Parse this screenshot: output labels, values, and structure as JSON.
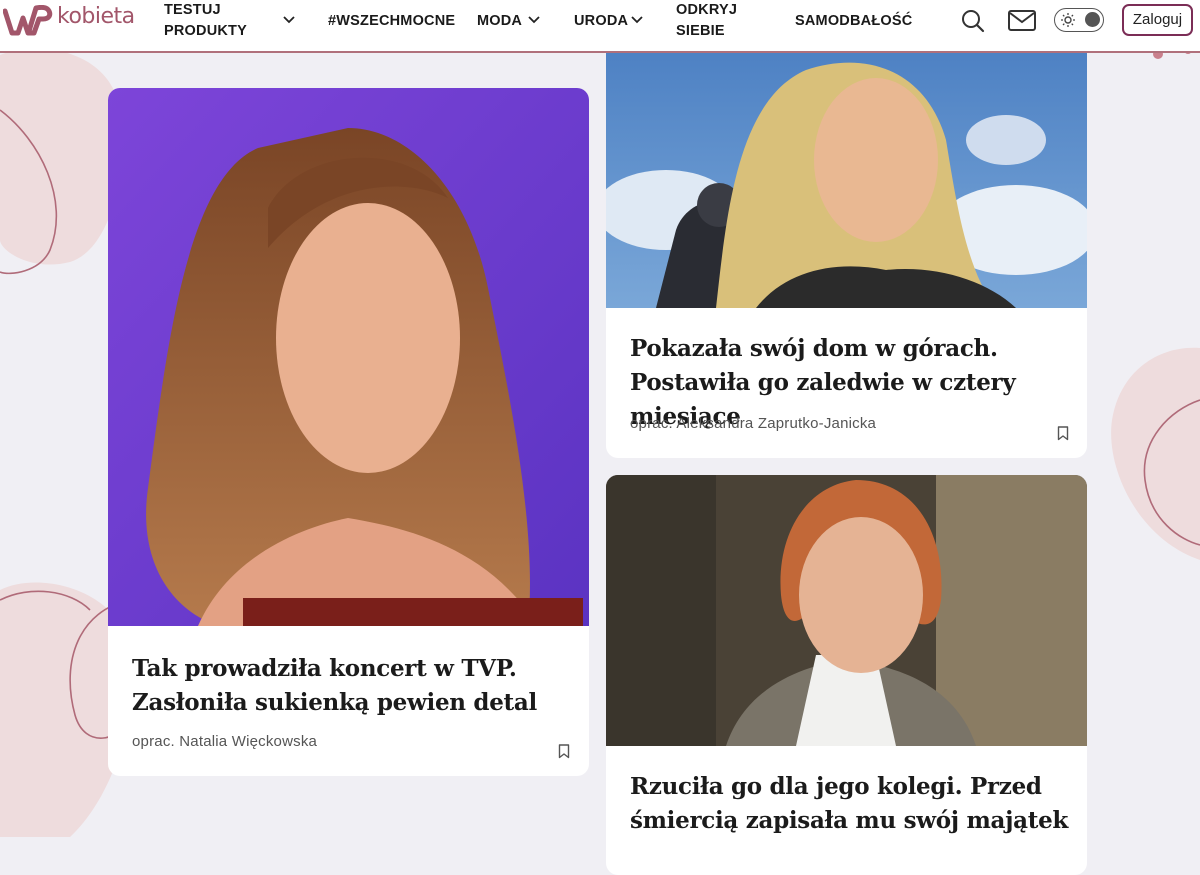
{
  "header": {
    "logo_text": "kobieta",
    "nav": [
      {
        "line1": "TESTUJ",
        "line2": "PRODUKTY"
      },
      {
        "label": "#WSZECHMOCNE"
      },
      {
        "label": "MODA"
      },
      {
        "label": "URODA"
      },
      {
        "line1": "ODKRYJ",
        "line2": "SIEBIE"
      },
      {
        "label": "SAMODBAŁOŚĆ"
      }
    ],
    "login_label": "Zaloguj"
  },
  "articles": [
    {
      "title": "Tak prowadziła koncert w TVP. Zasłoniła sukienką pewien detal",
      "author": "oprac. Natalia Więckowska"
    },
    {
      "title": "Pokazała swój dom w górach. Postawiła go zaledwie w cztery miesiące",
      "author": "oprac. Aleksandra Zaprutko-Janicka"
    },
    {
      "title": "Rzuciła go dla jego kolegi. Przed śmiercią zapisała mu swój majątek"
    }
  ],
  "colors": {
    "accent": "#a2566a",
    "login_border": "#7b2d56",
    "background": "#f0eff4"
  },
  "icons": [
    "wp-logo",
    "chevron-down-icon",
    "search-icon",
    "mail-icon",
    "sun-icon",
    "bookmark-icon"
  ]
}
